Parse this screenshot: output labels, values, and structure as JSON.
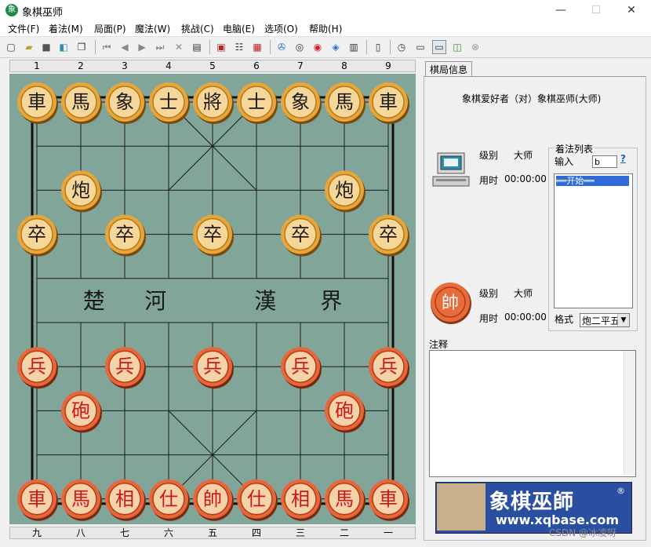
{
  "window": {
    "title": "象棋巫师",
    "app_icon": "象",
    "minimize": "—",
    "maximize": "☐",
    "close": "✕"
  },
  "menu": [
    "文件(F)",
    "着法(M)",
    "局面(P)",
    "魔法(W)",
    "挑战(C)",
    "电脑(E)",
    "选项(O)",
    "帮助(H)"
  ],
  "toolbar_icons": [
    "new-icon",
    "open-icon",
    "save-icon",
    "print-icon",
    "copy-icon",
    "first-move-icon",
    "prev-move-icon",
    "next-move-icon",
    "last-move-icon",
    "delete-icon",
    "paste-icon",
    "flip-icon",
    "tree-icon",
    "grid-icon",
    "color-wheel-icon",
    "analysis-icon",
    "spiral-icon",
    "doc-icon",
    "notebook-icon",
    "book-icon",
    "clock-icon",
    "computer-icon",
    "monitor-icon",
    "chart-icon",
    "stop-icon"
  ],
  "board": {
    "top_labels": [
      "1",
      "2",
      "3",
      "4",
      "5",
      "6",
      "7",
      "8",
      "9"
    ],
    "bottom_labels": [
      "九",
      "八",
      "七",
      "六",
      "五",
      "四",
      "三",
      "二",
      "一"
    ],
    "river": [
      "楚",
      "河",
      "漢",
      "界"
    ],
    "black_pieces": [
      {
        "char": "車",
        "col": 0,
        "row": 0
      },
      {
        "char": "馬",
        "col": 1,
        "row": 0
      },
      {
        "char": "象",
        "col": 2,
        "row": 0
      },
      {
        "char": "士",
        "col": 3,
        "row": 0
      },
      {
        "char": "將",
        "col": 4,
        "row": 0
      },
      {
        "char": "士",
        "col": 5,
        "row": 0
      },
      {
        "char": "象",
        "col": 6,
        "row": 0
      },
      {
        "char": "馬",
        "col": 7,
        "row": 0
      },
      {
        "char": "車",
        "col": 8,
        "row": 0
      },
      {
        "char": "炮",
        "col": 1,
        "row": 2
      },
      {
        "char": "炮",
        "col": 7,
        "row": 2
      },
      {
        "char": "卒",
        "col": 0,
        "row": 3
      },
      {
        "char": "卒",
        "col": 2,
        "row": 3
      },
      {
        "char": "卒",
        "col": 4,
        "row": 3
      },
      {
        "char": "卒",
        "col": 6,
        "row": 3
      },
      {
        "char": "卒",
        "col": 8,
        "row": 3
      }
    ],
    "red_pieces": [
      {
        "char": "兵",
        "col": 0,
        "row": 6
      },
      {
        "char": "兵",
        "col": 2,
        "row": 6
      },
      {
        "char": "兵",
        "col": 4,
        "row": 6
      },
      {
        "char": "兵",
        "col": 6,
        "row": 6
      },
      {
        "char": "兵",
        "col": 8,
        "row": 6
      },
      {
        "char": "砲",
        "col": 1,
        "row": 7
      },
      {
        "char": "砲",
        "col": 7,
        "row": 7
      },
      {
        "char": "車",
        "col": 0,
        "row": 9
      },
      {
        "char": "馬",
        "col": 1,
        "row": 9
      },
      {
        "char": "相",
        "col": 2,
        "row": 9
      },
      {
        "char": "仕",
        "col": 3,
        "row": 9
      },
      {
        "char": "帥",
        "col": 4,
        "row": 9
      },
      {
        "char": "仕",
        "col": 5,
        "row": 9
      },
      {
        "char": "相",
        "col": 6,
        "row": 9
      },
      {
        "char": "馬",
        "col": 7,
        "row": 9
      },
      {
        "char": "車",
        "col": 8,
        "row": 9
      }
    ]
  },
  "info": {
    "tab": "棋局信息",
    "matchup": "象棋爱好者（对）象棋巫师(大师)",
    "computer": {
      "level_label": "级别",
      "level": "大师",
      "time_label": "用时",
      "time": "00:00:00"
    },
    "player": {
      "piece": "帥",
      "level_label": "级别",
      "level": "大师",
      "time_label": "用时",
      "time": "00:00:00"
    },
    "moves": {
      "title": "着法列表",
      "input_label": "输入",
      "input_value": "b",
      "help": "?",
      "first_item": "══开始══",
      "format_label": "格式",
      "format_value": "炮二平五"
    },
    "notes_label": "注释"
  },
  "banner": {
    "title": "象棋巫師",
    "reg": "®",
    "url": "www.xqbase.com"
  },
  "watermark": "CSDN @冰凌呀",
  "colors": {
    "board": "#82a59a",
    "black_text": "#1a1a1a",
    "red_text": "#c8181b",
    "piece_black": "#e7a63a",
    "piece_red": "#e6683a"
  }
}
